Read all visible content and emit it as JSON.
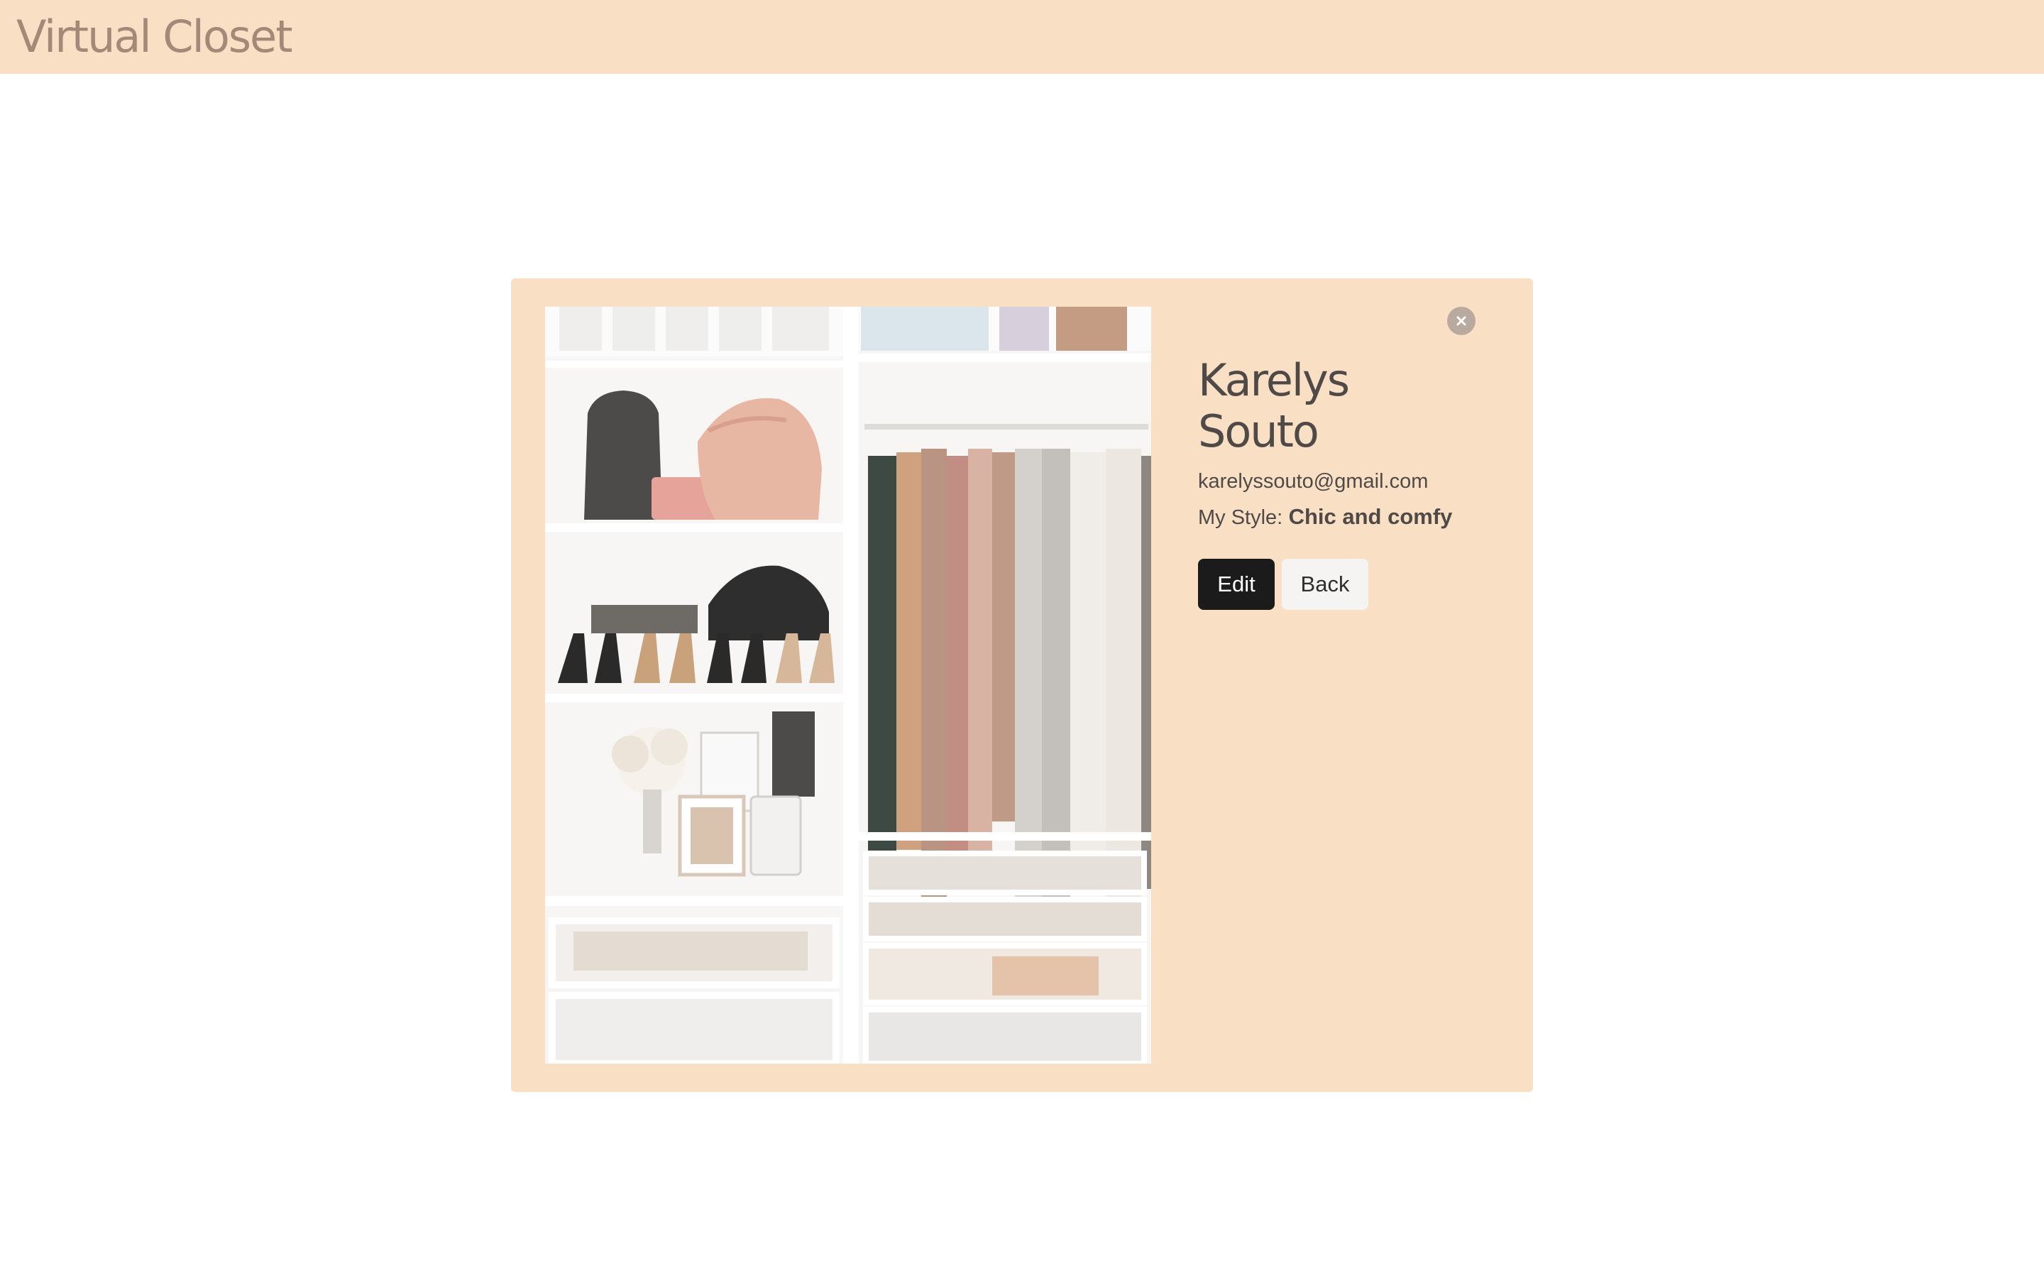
{
  "app": {
    "title": "Virtual Closet"
  },
  "profile": {
    "first_name": "Karelys",
    "last_name": "Souto",
    "email": "karelyssouto@gmail.com",
    "style_label": "My Style:",
    "style_value": "Chic and comfy",
    "photo_description": "closet-photo"
  },
  "actions": {
    "edit_label": "Edit",
    "back_label": "Back",
    "close_icon": "close-icon"
  },
  "colors": {
    "header_bg": "#f9dfc3",
    "card_bg": "#f9dfc3",
    "brand_text": "#a38a78",
    "edit_bg": "#1b1b1b",
    "back_bg": "#f6f4f2"
  }
}
